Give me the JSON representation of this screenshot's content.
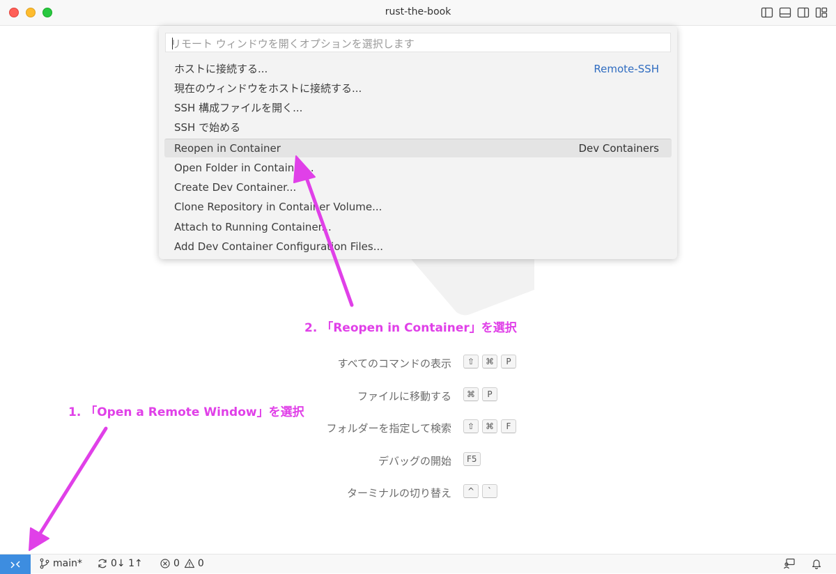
{
  "window": {
    "title": "rust-the-book"
  },
  "quickpick": {
    "placeholder": "リモート ウィンドウを開くオプションを選択します",
    "items": [
      {
        "label": "ホストに接続する...",
        "detail": "Remote-SSH"
      },
      {
        "label": "現在のウィンドウをホストに接続する...",
        "detail": ""
      },
      {
        "label": "SSH 構成ファイルを開く...",
        "detail": ""
      },
      {
        "label": "SSH で始める",
        "detail": ""
      },
      {
        "label": "Reopen in Container",
        "detail": "Dev Containers"
      },
      {
        "label": "Open Folder in Container...",
        "detail": ""
      },
      {
        "label": "Create Dev Container...",
        "detail": ""
      },
      {
        "label": "Clone Repository in Container Volume...",
        "detail": ""
      },
      {
        "label": "Attach to Running Container...",
        "detail": ""
      },
      {
        "label": "Add Dev Container Configuration Files...",
        "detail": ""
      }
    ]
  },
  "shortcuts": [
    {
      "label": "すべてのコマンドの表示",
      "keys": [
        "⇧",
        "⌘",
        "P"
      ]
    },
    {
      "label": "ファイルに移動する",
      "keys": [
        "⌘",
        "P"
      ]
    },
    {
      "label": "フォルダーを指定して検索",
      "keys": [
        "⇧",
        "⌘",
        "F"
      ]
    },
    {
      "label": "デバッグの開始",
      "keys": [
        "F5"
      ]
    },
    {
      "label": "ターミナルの切り替え",
      "keys": [
        "^",
        "`"
      ]
    }
  ],
  "annotations": {
    "step1": "1. 「Open a Remote Window」を選択",
    "step2": "2. 「Reopen in Container」を選択"
  },
  "statusbar": {
    "branch": "main*",
    "sync": "0↓ 1↑",
    "errors": "0",
    "warnings": "0"
  },
  "colors": {
    "accent": "#3d8de0",
    "annotation": "#e040e8",
    "link": "#2f6cc0"
  }
}
